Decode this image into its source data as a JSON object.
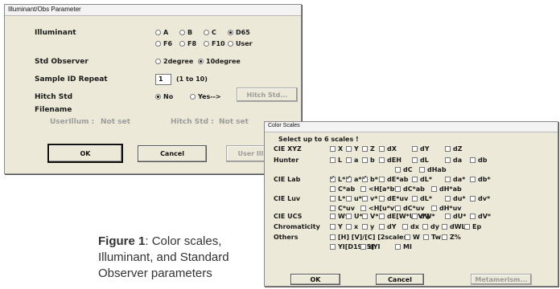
{
  "ill": {
    "title": "Illuminant/Obs Parameter",
    "illuminant_label": "Illuminant",
    "illuminant_options": [
      {
        "label": "A",
        "checked": false
      },
      {
        "label": "B",
        "checked": false
      },
      {
        "label": "C",
        "checked": false
      },
      {
        "label": "D65",
        "checked": true
      },
      {
        "label": "F6",
        "checked": false
      },
      {
        "label": "F8",
        "checked": false
      },
      {
        "label": "F10",
        "checked": false
      },
      {
        "label": "User",
        "checked": false
      }
    ],
    "observer_label": "Std Observer",
    "observer_options": [
      {
        "label": "2degree",
        "checked": false
      },
      {
        "label": "10degree",
        "checked": true
      }
    ],
    "repeat_label": "Sample ID Repeat",
    "repeat_value": "1",
    "repeat_hint": "(1 to 10)",
    "hitch_label": "Hitch Std",
    "hitch_options": [
      {
        "label": "No",
        "checked": true
      },
      {
        "label": "Yes-->",
        "checked": false
      }
    ],
    "hitch_button": "Hitch Std...",
    "filename_label": "Filename",
    "userillum_label": "UserIllum :",
    "userillum_value": "Not set",
    "hitchstd_label": "Hitch Std :",
    "hitchstd_value": "Not set",
    "ok": "OK",
    "cancel": "Cancel",
    "user_illum": "User Illum..."
  },
  "cs": {
    "title": "Color Scales",
    "heading": "Select up to 6 scales !",
    "rows": [
      {
        "label": "CIE XYZ",
        "lines": [
          [
            {
              "t": "X",
              "c": false
            },
            {
              "t": "Y",
              "c": false
            },
            {
              "t": "Z",
              "c": false
            },
            {
              "t": "dX",
              "c": false
            },
            {
              "t": "dY",
              "c": false
            },
            {
              "t": "dZ",
              "c": false
            }
          ]
        ]
      },
      {
        "label": "Hunter",
        "lines": [
          [
            {
              "t": "L",
              "c": false
            },
            {
              "t": "a",
              "c": false
            },
            {
              "t": "b",
              "c": false
            },
            {
              "t": "dEH",
              "c": false
            },
            {
              "t": "dL",
              "c": false
            },
            {
              "t": "da",
              "c": false
            },
            {
              "t": "db",
              "c": false
            }
          ],
          [
            {
              "t": "dC",
              "c": false
            },
            {
              "t": "dHab",
              "c": false
            }
          ]
        ]
      },
      {
        "label": "CIE Lab",
        "lines": [
          [
            {
              "t": "L*",
              "c": true
            },
            {
              "t": "a*",
              "c": true
            },
            {
              "t": "b*",
              "c": true
            },
            {
              "t": "dE*ab",
              "c": false
            },
            {
              "t": "dL*",
              "c": false
            },
            {
              "t": "da*",
              "c": false
            },
            {
              "t": "db*",
              "c": false
            }
          ],
          [
            {
              "t": "C*ab",
              "c": false
            },
            {
              "t": "<H[a*b*]",
              "c": false
            },
            {
              "t": "dC*ab",
              "c": false
            },
            {
              "t": "dH*ab",
              "c": false
            }
          ]
        ]
      },
      {
        "label": "CIE Luv",
        "lines": [
          [
            {
              "t": "L*",
              "c": false
            },
            {
              "t": "u*",
              "c": false
            },
            {
              "t": "v*",
              "c": false
            },
            {
              "t": "dE*uv",
              "c": false
            },
            {
              "t": "dL*",
              "c": false
            },
            {
              "t": "du*",
              "c": false
            },
            {
              "t": "dv*",
              "c": false
            }
          ],
          [
            {
              "t": "C*uv",
              "c": false
            },
            {
              "t": "<H[u*v*]",
              "c": false
            },
            {
              "t": "dC*uv",
              "c": false
            },
            {
              "t": "dH*uv",
              "c": false
            }
          ]
        ]
      },
      {
        "label": "CIE UCS",
        "lines": [
          [
            {
              "t": "W*",
              "c": false
            },
            {
              "t": "U*",
              "c": false
            },
            {
              "t": "V*",
              "c": false
            },
            {
              "t": "dE[W*U*V*]",
              "c": false
            },
            {
              "t": "dW*",
              "c": false
            },
            {
              "t": "dU*",
              "c": false
            },
            {
              "t": "dV*",
              "c": false
            }
          ]
        ]
      },
      {
        "label": "Chromaticity",
        "lines": [
          [
            {
              "t": "Y",
              "c": false
            },
            {
              "t": "x",
              "c": false
            },
            {
              "t": "y",
              "c": false
            },
            {
              "t": "dY",
              "c": false
            },
            {
              "t": "dx",
              "c": false
            },
            {
              "t": "dy",
              "c": false
            },
            {
              "t": "dWL",
              "c": false
            },
            {
              "t": "Ep",
              "c": false
            }
          ]
        ]
      },
      {
        "label": "Others",
        "lines": [
          [
            {
              "t": "[H] [V]/[C] [2scales]",
              "c": false
            },
            {
              "t": "W",
              "c": false
            },
            {
              "t": "Tw",
              "c": false
            },
            {
              "t": "Z%",
              "c": false
            }
          ],
          [
            {
              "t": "YI[D1925]",
              "c": false
            },
            {
              "t": "dYI",
              "c": false
            },
            {
              "t": "MI",
              "c": false
            }
          ]
        ]
      }
    ],
    "ok": "OK",
    "cancel": "Cancel",
    "metamerism": "Metamerism..."
  },
  "caption": {
    "bold": "Figure 1",
    "rest1": ": Color scales,",
    "rest2": "Illuminant, and Standard",
    "rest3": "Observer parameters"
  }
}
